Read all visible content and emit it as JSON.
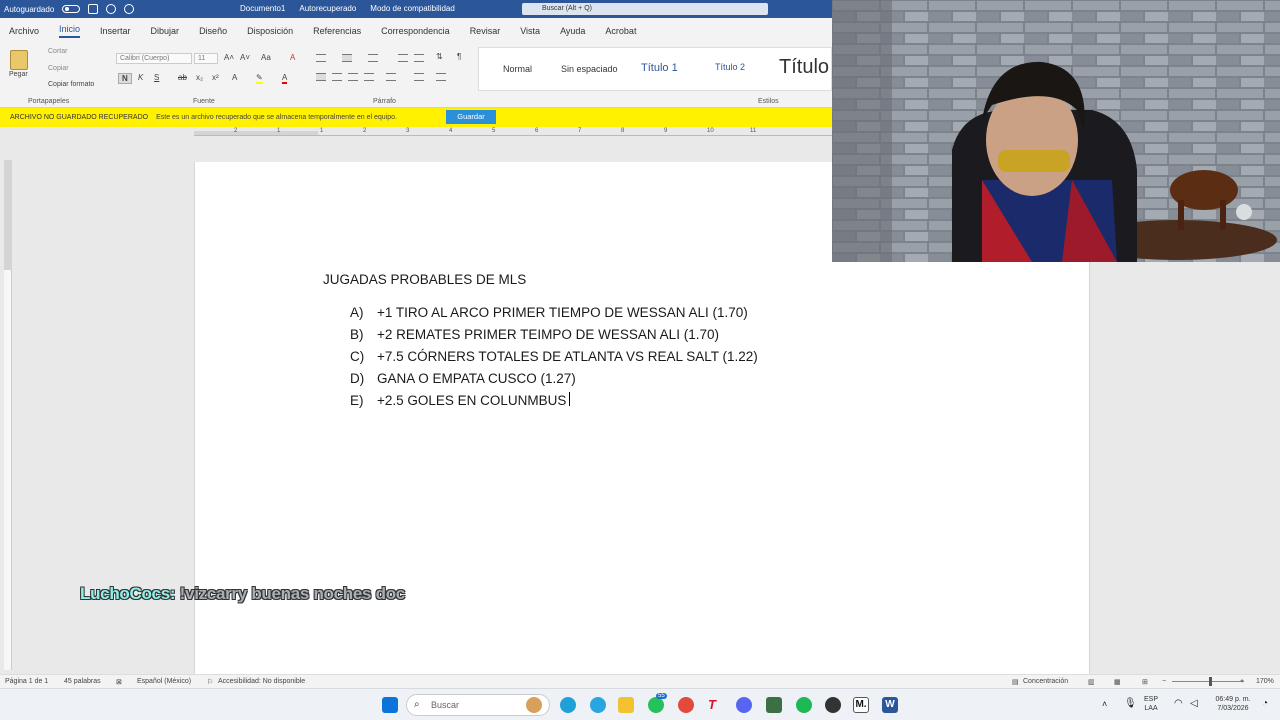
{
  "titlebar": {
    "autosave": "Autoguardado",
    "document": "Documento1",
    "recovered_tag": "Autorecuperado",
    "compat": "Modo de compatibilidad",
    "search_placeholder": "Buscar (Alt + Q)"
  },
  "tabs": [
    "Archivo",
    "Inicio",
    "Insertar",
    "Dibujar",
    "Diseño",
    "Disposición",
    "Referencias",
    "Correspondencia",
    "Revisar",
    "Vista",
    "Ayuda",
    "Acrobat"
  ],
  "active_tab": "Inicio",
  "ribbon": {
    "clipboard": {
      "paste": "Pegar",
      "cut": "Cortar",
      "copy": "Copiar",
      "format_painter": "Copiar formato",
      "label": "Portapapeles"
    },
    "font": {
      "name": "Calibri (Cuerpo)",
      "size": "11",
      "label": "Fuente"
    },
    "paragraph": {
      "label": "Párrafo"
    },
    "styles": {
      "items": [
        "Normal",
        "Sin espaciado",
        "Título 1",
        "Título 2",
        "Título"
      ],
      "label": "Estilos"
    }
  },
  "recovered_bar": {
    "title": "ARCHIVO NO GUARDADO RECUPERADO",
    "message": "Este es un archivo recuperado que se almacena temporalmente en el equipo.",
    "save_button": "Guardar"
  },
  "ruler_ticks": [
    "2",
    "1",
    "1",
    "2",
    "3",
    "4",
    "5",
    "6",
    "7",
    "8",
    "9",
    "10",
    "11"
  ],
  "document": {
    "title": "JUGADAS PROBABLES DE MLS",
    "items": [
      {
        "label": "A)",
        "text": "+1 TIRO AL ARCO PRIMER TIEMPO DE WESSAN ALI (1.70)"
      },
      {
        "label": "B)",
        "text": "+2 REMATES PRIMER TEIMPO DE WESSAN ALI (1.70)"
      },
      {
        "label": "C)",
        "text": "+7.5 CÓRNERS TOTALES DE ATLANTA VS REAL SALT (1.22)"
      },
      {
        "label": "D)",
        "text": "GANA O EMPATA CUSCO (1.27)"
      },
      {
        "label": "E)",
        "text": "+2.5 GOLES EN COLUNMBUS"
      }
    ]
  },
  "chat": {
    "user": "LuchoCocs:",
    "message": "!vizcarry buenas noches doc"
  },
  "statusbar": {
    "page": "Página 1 de 1",
    "words": "45 palabras",
    "language": "Español (México)",
    "accessibility": "Accesibilidad: No disponible",
    "focus": "Concentración",
    "zoom": "170%"
  },
  "taskbar": {
    "search_placeholder": "Buscar",
    "badge": "55",
    "lang_top": "ESP",
    "lang_bottom": "LAA",
    "time": "06:49 p. m.",
    "date": "7/03/2026"
  }
}
